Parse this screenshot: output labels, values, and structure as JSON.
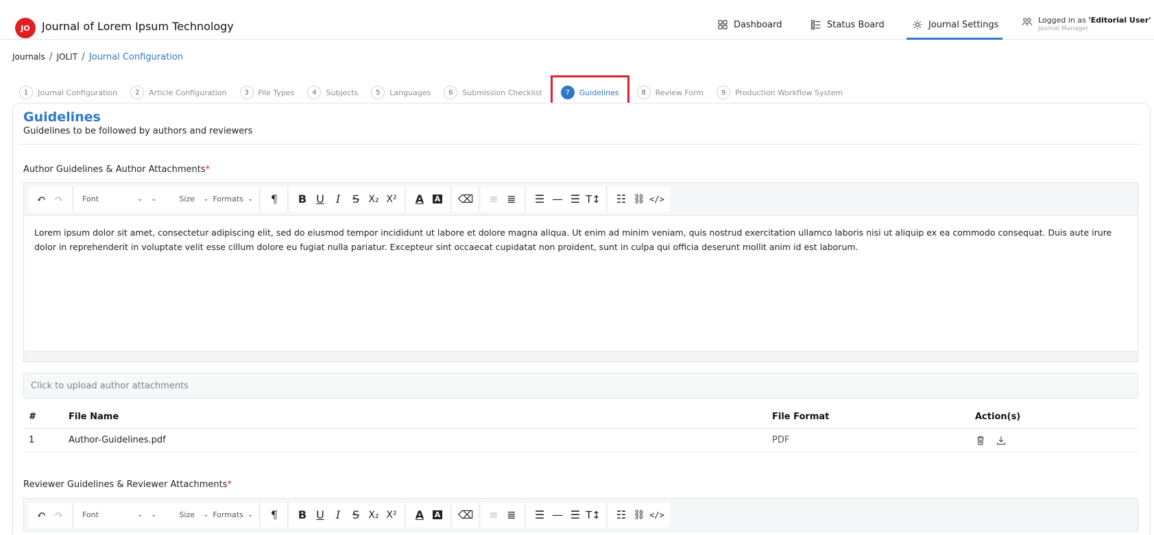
{
  "header": {
    "logo_initials": "JO",
    "app_title": "Journal of Lorem Ipsum Technology",
    "nav": [
      {
        "label": "Dashboard",
        "icon": "grid-icon"
      },
      {
        "label": "Status Board",
        "icon": "board-icon"
      },
      {
        "label": "Journal Settings",
        "icon": "gear-icon",
        "active": true
      }
    ],
    "user": {
      "prefix": "Logged in as ",
      "name": "'Editorial User'",
      "role": "Journal Manager"
    }
  },
  "breadcrumb": [
    "Journals",
    "JOLIT",
    "Journal Configuration"
  ],
  "steps": [
    {
      "num": "1",
      "label": "Journal Configuration"
    },
    {
      "num": "2",
      "label": "Article Configuration"
    },
    {
      "num": "3",
      "label": "File Types"
    },
    {
      "num": "4",
      "label": "Subjects"
    },
    {
      "num": "5",
      "label": "Languages"
    },
    {
      "num": "6",
      "label": "Submission Checklist"
    },
    {
      "num": "7",
      "label": "Guidelines",
      "active": true
    },
    {
      "num": "8",
      "label": "Review Form"
    },
    {
      "num": "9",
      "label": "Production Workflow System"
    }
  ],
  "section": {
    "title": "Guidelines",
    "subtitle": "Guidelines to be followed by authors and reviewers"
  },
  "author": {
    "label": "Author Guidelines & Author Attachments",
    "required_mark": "*",
    "content": "Lorem ipsum dolor sit amet, consectetur adipiscing elit, sed do eiusmod tempor incididunt ut labore et dolore magna aliqua. Ut enim ad minim veniam, quis nostrud exercitation ullamco laboris nisi ut aliquip ex ea commodo consequat. Duis aute irure dolor in reprehenderit in voluptate velit esse cillum dolore eu fugiat nulla pariatur. Excepteur sint occaecat cupidatat non proident, sunt in culpa qui officia deserunt mollit anim id est laborum.",
    "upload_placeholder": "Click to upload author attachments"
  },
  "toolbar": {
    "font": "Font",
    "size": "Size",
    "formats": "Formats"
  },
  "table": {
    "headers": {
      "idx": "#",
      "name": "File Name",
      "format": "File Format",
      "actions": "Action(s)"
    },
    "rows": [
      {
        "idx": "1",
        "name": "Author-Guidelines.pdf",
        "format": "PDF"
      }
    ]
  },
  "reviewer": {
    "label": "Reviewer Guidelines & Reviewer Attachments",
    "required_mark": "*"
  },
  "colors": {
    "accent": "#2f77c9",
    "highlight": "#e0202f",
    "logo": "#e02020"
  }
}
